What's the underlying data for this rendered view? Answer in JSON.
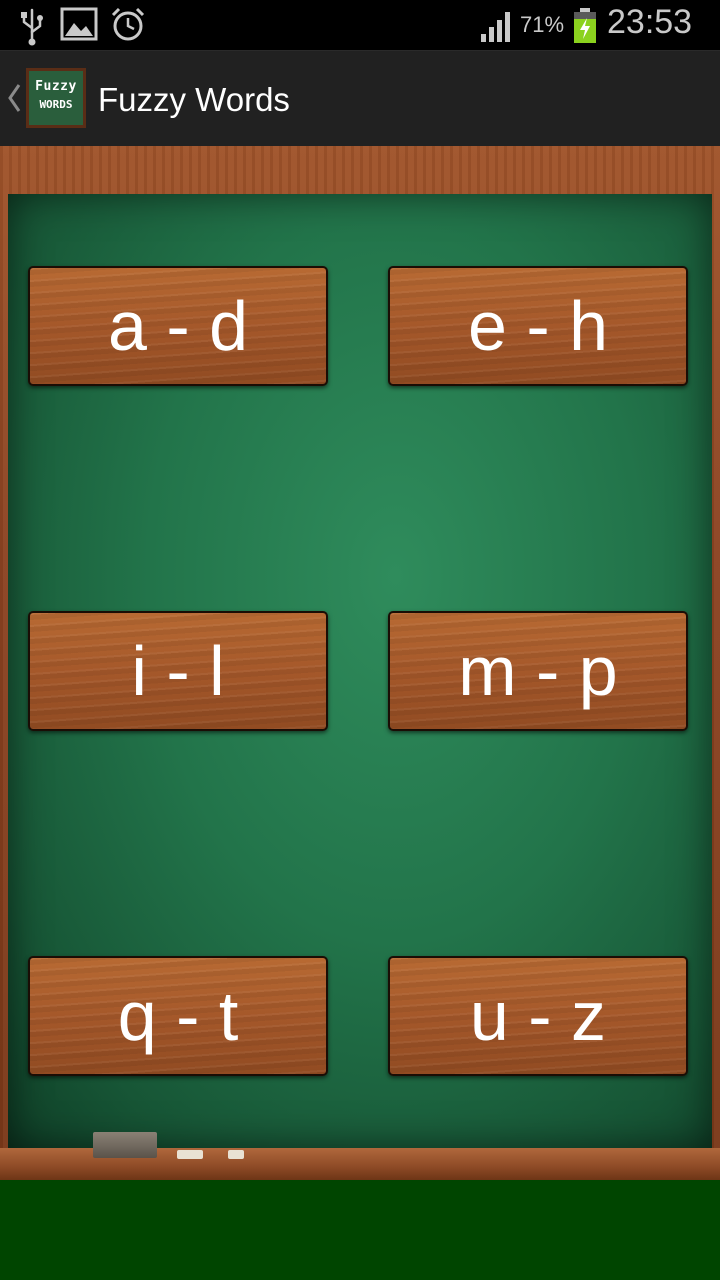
{
  "status_bar": {
    "battery_percent": "71%",
    "time": "23:53",
    "icons": [
      "usb-icon",
      "image-icon",
      "alarm-icon",
      "signal-icon",
      "battery-charging-icon"
    ]
  },
  "action_bar": {
    "title": "Fuzzy Words",
    "logo_line1": "Fuzzy",
    "logo_line2": "WORDS",
    "back_icon": "chevron-left-icon"
  },
  "letter_groups": [
    {
      "label": "a - d"
    },
    {
      "label": "e - h"
    },
    {
      "label": "i - l"
    },
    {
      "label": "m - p"
    },
    {
      "label": "q - t"
    },
    {
      "label": "u - z"
    }
  ],
  "colors": {
    "chalkboard": "#22744a",
    "wood": "#a5582a",
    "bottom_bar": "#004500"
  }
}
